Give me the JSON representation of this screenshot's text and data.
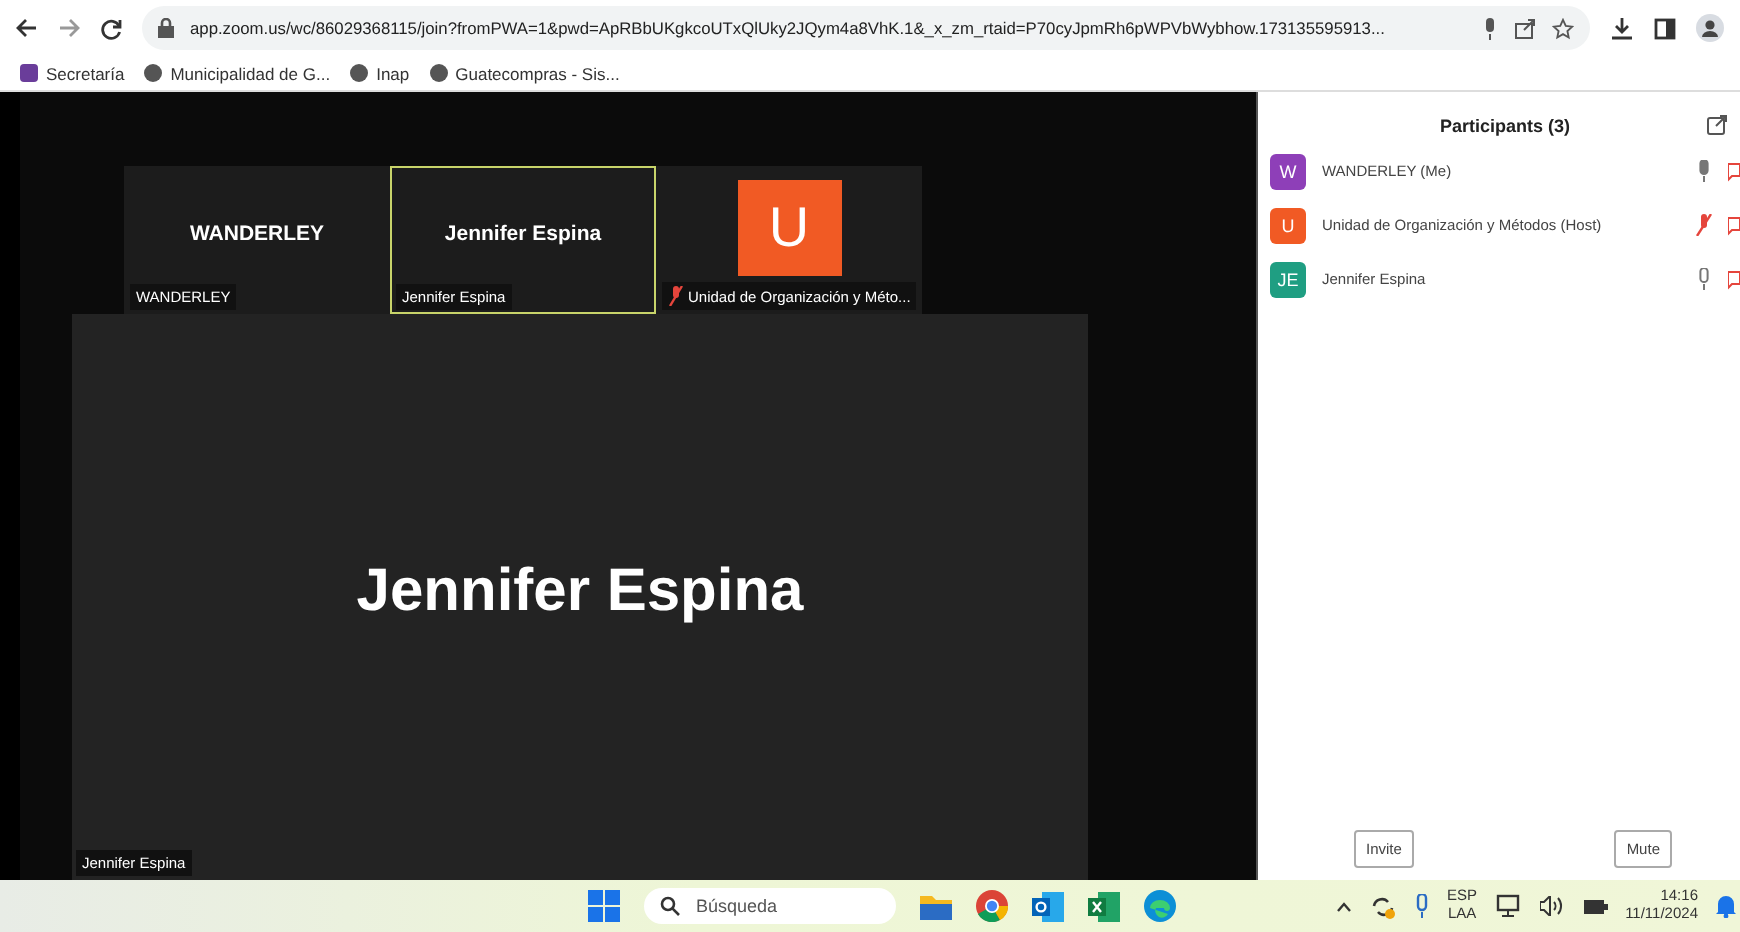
{
  "browser": {
    "url": "app.zoom.us/wc/86029368115/join?fromPWA=1&pwd=ApRBbUKgkcoUTxQlUky2JQym4a8VhK.1&_x_zm_rtaid=P70cyJpmRh6pWPVbWybhow.173135595913...",
    "bookmarks": [
      {
        "label": "Secretaría"
      },
      {
        "label": "Municipalidad de G..."
      },
      {
        "label": "Inap"
      },
      {
        "label": "Guatecompras - Sis..."
      }
    ]
  },
  "tiles": [
    {
      "name": "WANDERLEY",
      "caption": "WANDERLEY",
      "selected": false,
      "muted": false,
      "kind": "name"
    },
    {
      "name": "Jennifer Espina",
      "caption": "Jennifer Espina",
      "selected": true,
      "muted": false,
      "kind": "name"
    },
    {
      "name": "U",
      "caption": "Unidad de Organización y Méto...",
      "selected": false,
      "muted": true,
      "kind": "avatar",
      "color": "#f15a24"
    }
  ],
  "speaker": {
    "name": "Jennifer Espina",
    "caption": "Jennifer Espina"
  },
  "participants_panel": {
    "title": "Participants (3)",
    "participants": [
      {
        "initials": "W",
        "name": "WANDERLEY (Me)",
        "color": "#8e3fb8",
        "muted": false
      },
      {
        "initials": "U",
        "name": "Unidad de Organización y Métodos (Host)",
        "color": "#f15a24",
        "muted": true
      },
      {
        "initials": "JE",
        "name": "Jennifer Espina",
        "color": "#1f9e82",
        "muted": false
      }
    ],
    "buttons": [
      "Invite",
      "Mute"
    ]
  },
  "taskbar": {
    "search_placeholder": "Búsqueda",
    "language": "ESP",
    "layout": "LAA",
    "time": "14:16",
    "date": "11/11/2024"
  }
}
